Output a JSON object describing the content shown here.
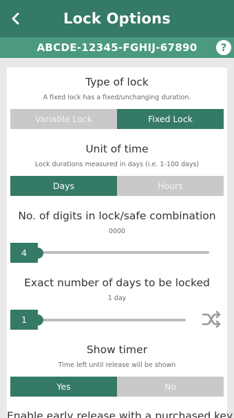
{
  "appbar": {
    "title": "Lock Options",
    "back_icon": "back-arrow-icon"
  },
  "code_bar": {
    "code": "ABCDE-12345-FGHIJ-67890",
    "help_label": "?"
  },
  "lock_type": {
    "title": "Type of lock",
    "description": "A fixed lock has a fixed/unchanging duration.",
    "options": [
      "Variable Lock",
      "Fixed Lock"
    ],
    "selected": "Fixed Lock"
  },
  "time_unit": {
    "title": "Unit of time",
    "description": "Lock durations measured in days (i.e. 1-100 days)",
    "options": [
      "Days",
      "Hours"
    ],
    "selected": "Days"
  },
  "digits": {
    "title": "No. of digits in lock/safe combination",
    "preview": "0000",
    "value": "4"
  },
  "days_locked": {
    "title": "Exact number of days to be locked",
    "description": "1 day",
    "value": "1",
    "randomize_icon": "shuffle-icon"
  },
  "show_timer": {
    "title": "Show timer",
    "description": "Time left until release will be shown",
    "options": [
      "Yes",
      "No"
    ],
    "selected": "Yes"
  },
  "early_release": {
    "title": "Enable early release with a purchased key"
  },
  "colors": {
    "primary": "#357a66",
    "secondary": "#4b9a80",
    "inactive": "#c9c9c9",
    "background": "#e9e9e9"
  }
}
